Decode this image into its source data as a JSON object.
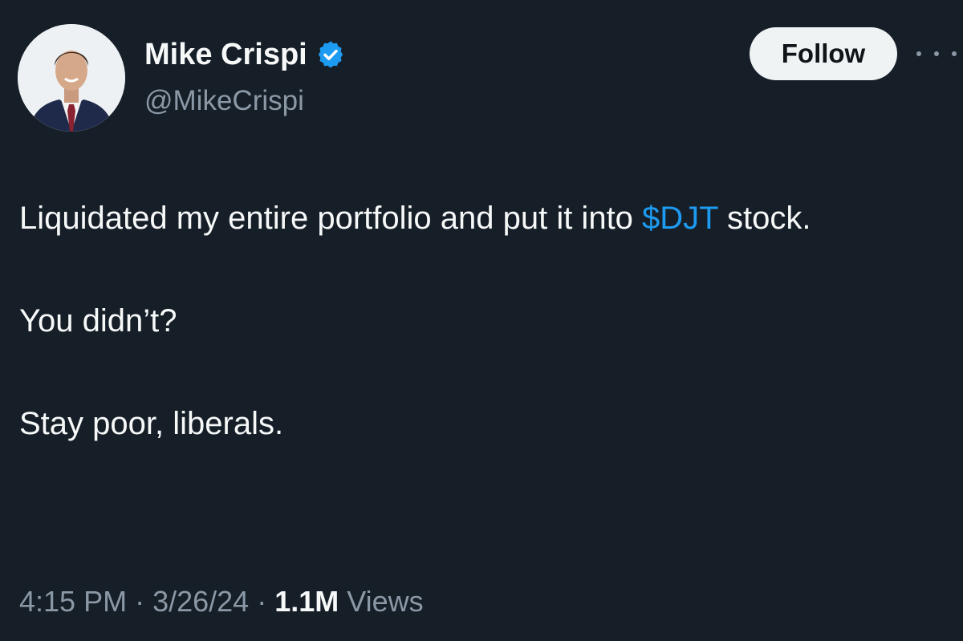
{
  "author": {
    "display_name": "Mike Crispi",
    "handle": "@MikeCrispi",
    "verified": true,
    "avatar_icon": "profile-photo"
  },
  "actions": {
    "follow_label": "Follow",
    "more_icon": "more-dots-icon"
  },
  "tweet": {
    "line1_prefix": "Liquidated my entire portfolio and put it into ",
    "cashtag": "$DJT",
    "line1_suffix": " stock.",
    "paragraph2": "You didn’t?",
    "paragraph3": "Stay poor, liberals."
  },
  "meta": {
    "time": "4:15 PM",
    "separator": " · ",
    "date": "3/26/24",
    "views_count": "1.1M",
    "views_label": " Views"
  },
  "colors": {
    "background": "#161e28",
    "link": "#1d9bf0",
    "secondary_text": "#8b98a5",
    "verified_badge": "#1d9bf0"
  }
}
